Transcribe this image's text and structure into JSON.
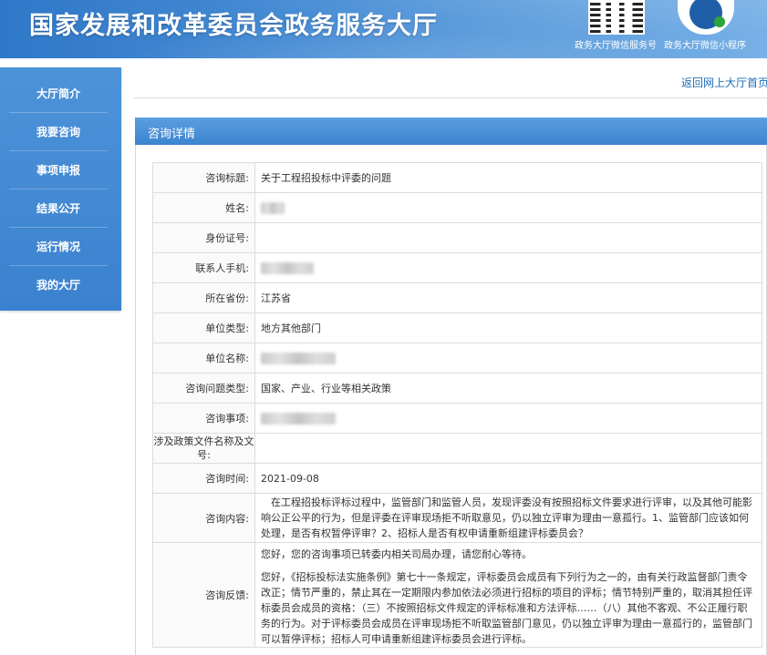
{
  "header": {
    "title": "国家发展和改革委员会政务服务大厅",
    "qr1_label": "政务大厅微信服务号",
    "qr2_label": "政务大厅微信小程序"
  },
  "sidebar": {
    "items": [
      {
        "label": "大厅简介"
      },
      {
        "label": "我要咨询"
      },
      {
        "label": "事项申报"
      },
      {
        "label": "结果公开"
      },
      {
        "label": "运行情况"
      },
      {
        "label": "我的大厅"
      }
    ]
  },
  "top_link": "返回网上大厅首页",
  "section": {
    "title": "咨询详情"
  },
  "details": {
    "title_label": "咨询标题:",
    "title_value": "关于工程招投标中评委的问题",
    "name_label": "姓名:",
    "id_label": "身份证号:",
    "phone_label": "联系人手机:",
    "province_label": "所在省份:",
    "province_value": "江苏省",
    "unit_type_label": "单位类型:",
    "unit_type_value": "地方其他部门",
    "unit_name_label": "单位名称:",
    "category_label": "咨询问题类型:",
    "category_value": "国家、产业、行业等相关政策",
    "matter_label": "咨询事项:",
    "policy_doc_label": "涉及政策文件名称及文号:",
    "date_label": "咨询时间:",
    "date_value": "2021-09-08",
    "content_label": "咨询内容:",
    "content_value": "　在工程招投标评标过程中，监管部门和监管人员，发现评委没有按照招标文件要求进行评审，以及其他可能影响公正公平的行为，但是评委在评审现场拒不听取意见，仍以独立评审为理由一意孤行。1、监管部门应该如何处理，是否有权暂停评审？2、招标人是否有权申请重新组建评标委员会？",
    "feedback_label": "咨询反馈:",
    "feedback_p1": "您好，您的咨询事项已转委内相关司局办理，请您耐心等待。",
    "feedback_p2": "您好，《招标投标法实施条例》第七十一条规定，评标委员会成员有下列行为之一的，由有关行政监督部门责令改正；情节严重的，禁止其在一定期限内参加依法必须进行招标的项目的评标；情节特别严重的，取消其担任评标委员会成员的资格：（三）不按照招标文件规定的评标标准和方法评标……（八）其他不客观、不公正履行职务的行为。对于评标委员会成员在评审现场拒不听取监管部门意见，仍以独立评审为理由一意孤行的，监管部门可以暂停评标；招标人可申请重新组建评标委员会进行评标。"
  }
}
